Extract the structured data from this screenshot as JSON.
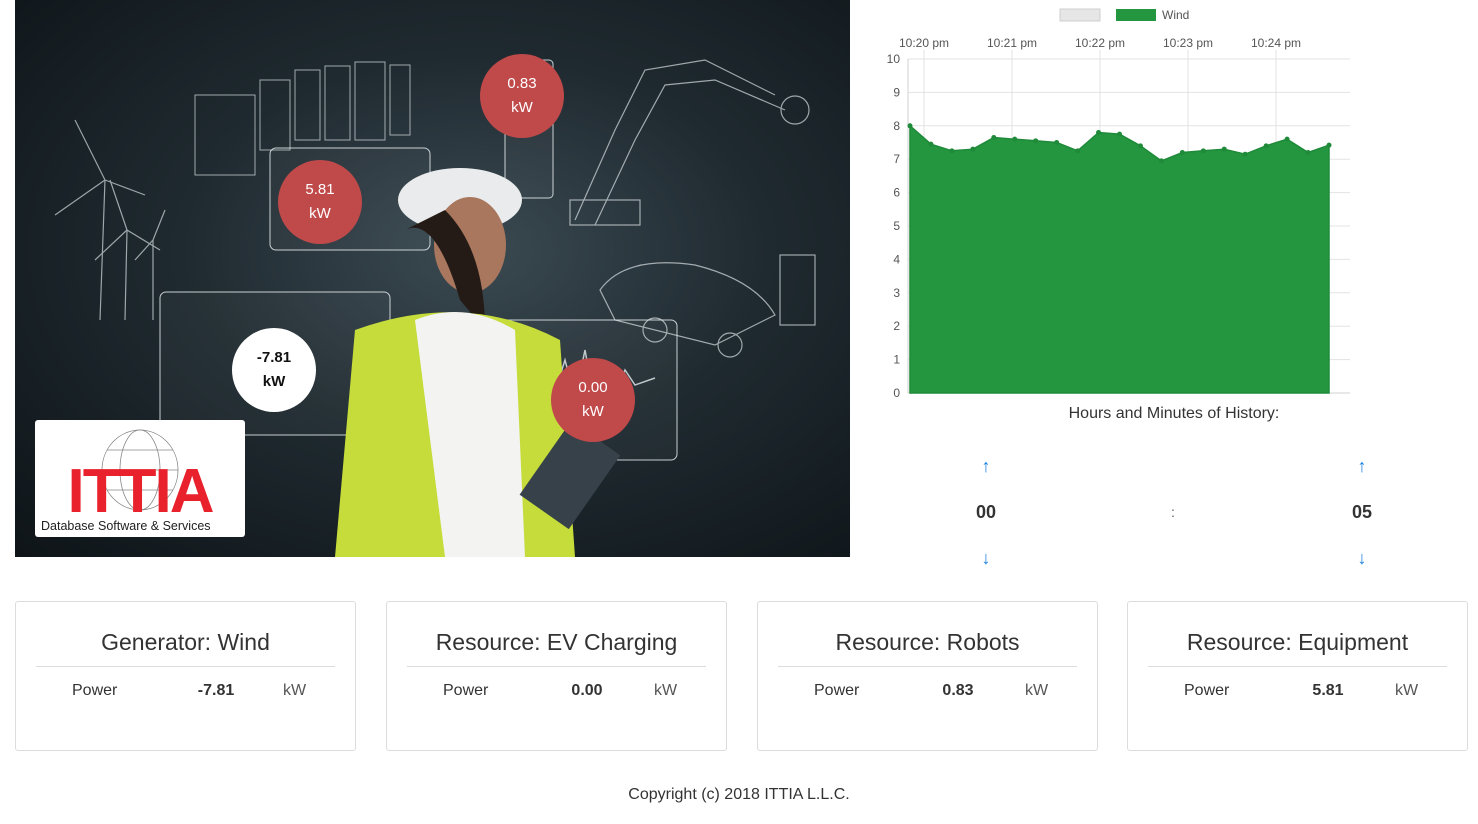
{
  "hero": {
    "bubbles": [
      {
        "value": "0.83",
        "unit": "kW"
      },
      {
        "value": "5.81",
        "unit": "kW"
      },
      {
        "value": "-7.81",
        "unit": "kW"
      },
      {
        "value": "0.00",
        "unit": "kW"
      }
    ],
    "logo": {
      "brand": "ITTIA",
      "tagline": "Database Software & Services"
    }
  },
  "chart_data": {
    "type": "area",
    "legend": [
      "",
      "Wind"
    ],
    "x_ticks": [
      "10:20 pm",
      "10:21 pm",
      "10:22 pm",
      "10:23 pm",
      "10:24 pm"
    ],
    "ylim": [
      0,
      10
    ],
    "y_ticks": [
      0,
      1,
      2,
      3,
      4,
      5,
      6,
      7,
      8,
      9,
      10
    ],
    "series": [
      {
        "name": "Wind",
        "color": "#23963f",
        "values": [
          8.0,
          7.45,
          7.25,
          7.3,
          7.65,
          7.6,
          7.55,
          7.5,
          7.25,
          7.8,
          7.75,
          7.4,
          6.95,
          7.2,
          7.25,
          7.3,
          7.15,
          7.4,
          7.6,
          7.2,
          7.42
        ]
      }
    ],
    "xlabel": "Hours and Minutes of History:"
  },
  "picker": {
    "hours": "00",
    "minutes": "05",
    "separator": ":",
    "up_icon": "arrow-up-icon",
    "down_icon": "arrow-down-icon"
  },
  "cards": [
    {
      "title": "Generator: Wind",
      "label": "Power",
      "value": "-7.81",
      "unit": "kW"
    },
    {
      "title": "Resource: EV Charging",
      "label": "Power",
      "value": "0.00",
      "unit": "kW"
    },
    {
      "title": "Resource: Robots",
      "label": "Power",
      "value": "0.83",
      "unit": "kW"
    },
    {
      "title": "Resource: Equipment",
      "label": "Power",
      "value": "5.81",
      "unit": "kW"
    }
  ],
  "footer": "Copyright (c) 2018 ITTIA L.L.C.",
  "colors": {
    "accent": "#1a7fe0",
    "bubble": "#c0494a",
    "wind": "#23963f",
    "logo_red": "#e8212c"
  }
}
